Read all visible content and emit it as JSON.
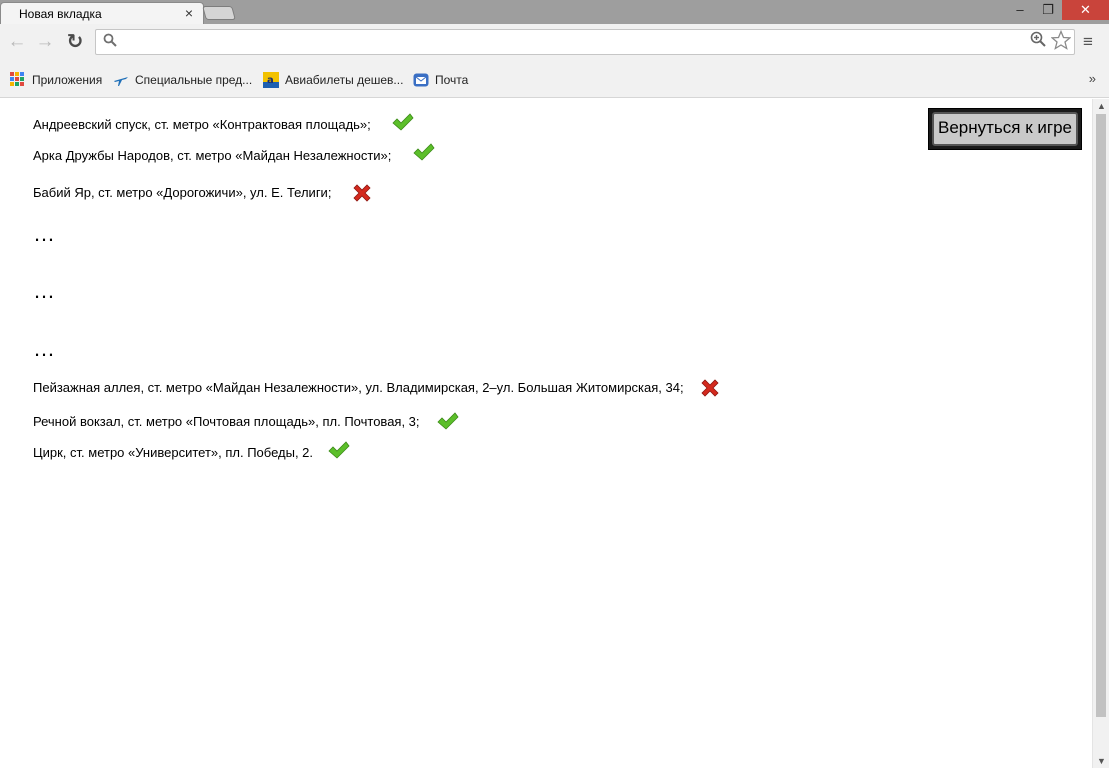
{
  "browser": {
    "tab_title": "Новая вкладка",
    "tab_close": "×",
    "address_value": "",
    "back_glyph": "←",
    "forward_glyph": "→",
    "reload_glyph": "↻",
    "window_min": "–",
    "window_max": "❐",
    "window_close": "✕",
    "menu_glyph": "≡"
  },
  "bookmarks": {
    "items": [
      {
        "label": "Приложения",
        "icon": "apps-grid-icon"
      },
      {
        "label": "Специальные пред...",
        "icon": "airplane-icon"
      },
      {
        "label": "Авиабилеты дешев...",
        "icon": "aviasales-icon"
      },
      {
        "label": "Почта",
        "icon": "mail-icon"
      }
    ],
    "overflow": "»"
  },
  "page": {
    "back_button": "Вернуться к игре",
    "locations": [
      {
        "text": "Андреевский спуск, ст. метро «Контрактовая площадь»;",
        "status": "correct"
      },
      {
        "text": "Арка Дружбы Народов, ст. метро «Майдан Незалежности»;",
        "status": "correct"
      },
      {
        "text": "Бабий Яр, ст. метро «Дорогожичи», ул. Е. Телиги;",
        "status": "wrong"
      },
      {
        "text": "Пейзажная аллея, ст. метро «Майдан Незалежности», ул. Владимирская, 2–ул. Большая Житомирская, 34;",
        "status": "wrong"
      },
      {
        "text": "Речной вокзал, ст. метро «Почтовая площадь», пл. Почтовая, 3;",
        "status": "correct"
      },
      {
        "text": "Цирк, ст. метро «Университет», пл. Победы, 2.",
        "status": "correct"
      }
    ],
    "ellipsis": [
      "…",
      "…",
      "…"
    ]
  },
  "colors": {
    "check_green": "#5cbf2a",
    "cross_red": "#d42a1e",
    "close_red": "#c9443b"
  }
}
